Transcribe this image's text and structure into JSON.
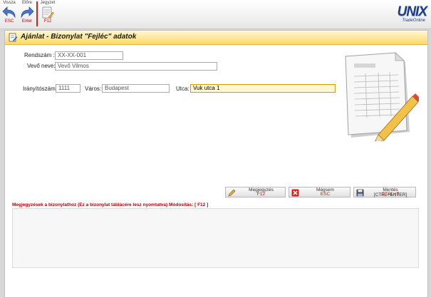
{
  "toolbar": {
    "back": {
      "label": "Vissza",
      "key": "ESC"
    },
    "forward": {
      "label": "Előre",
      "key": "Enter"
    },
    "notes": {
      "label": "Jegyzet",
      "key": "F12"
    }
  },
  "logo": {
    "text": "UNIX",
    "subtext": "TradeOnline"
  },
  "panel": {
    "title": "Ajánlat - Bizonylat \"Fejléc\" adatok"
  },
  "form": {
    "rendszam": {
      "label": "Rendszám :",
      "value": "XX-XX-001"
    },
    "vevo": {
      "label": "Vevő neve:",
      "value": "Vevő Vilmos"
    },
    "iranyitoszam": {
      "label": "Irányítószám:",
      "value": "1111"
    },
    "varos": {
      "label": "Város:",
      "value": "Budapest"
    },
    "utca": {
      "label": "Utca:",
      "value": "Vuk utca 1"
    }
  },
  "buttons": {
    "megjegyzes": {
      "label": "Megjegyzés",
      "key": "F12"
    },
    "megsem": {
      "label": "Mégsem",
      "key": "ESC"
    },
    "mentes": {
      "label": "Mentés [CTRL+ENTER]",
      "key": "CTRL+S"
    }
  },
  "notes": {
    "label": "Megjegyzések a bizonylathoz (Ez a bizonylat táblácére lesz nyomtatva) Módosítás: [ F12 ]",
    "value": ""
  }
}
